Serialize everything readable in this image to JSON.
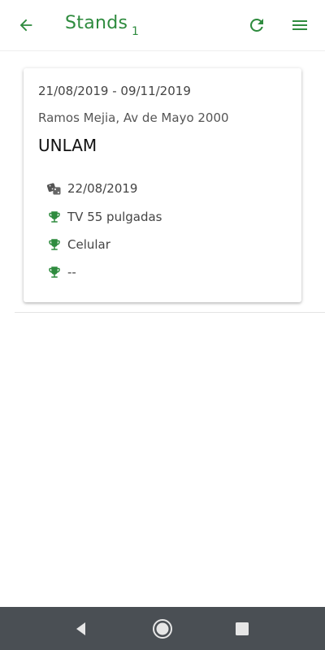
{
  "appbar": {
    "title": "Stands",
    "count": "1",
    "icons": {
      "back": "arrow-left-icon",
      "refresh": "refresh-icon",
      "menu": "hamburger-menu-icon"
    },
    "accent_color": "#2e8b3e"
  },
  "stand_card": {
    "dates": "21/08/2019 - 09/11/2019",
    "address": "Ramos Mejia, Av de Mayo 2000",
    "name": "UNLAM",
    "draw": {
      "icon": "dice-icon",
      "date": "22/08/2019"
    },
    "prizes": [
      {
        "icon": "trophy-icon",
        "label": "TV 55 pulgadas"
      },
      {
        "icon": "trophy-icon",
        "label": "Celular"
      },
      {
        "icon": "trophy-icon",
        "label": "--"
      }
    ]
  },
  "system_nav": {
    "icons": [
      "back-triangle-icon",
      "home-circle-icon",
      "recents-square-icon"
    ],
    "background": "#4a4f54"
  }
}
